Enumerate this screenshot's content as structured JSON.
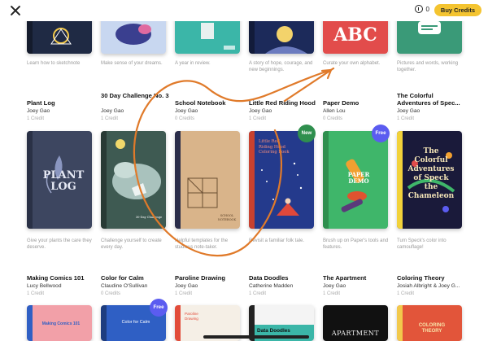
{
  "topbar": {
    "credits": "0",
    "buy_label": "Buy Credits"
  },
  "row1": [
    {
      "desc": "Learn how to sketchnote",
      "color": "#1f2a44",
      "accent": "#f2c94c"
    },
    {
      "desc": "Make sense of your dreams.",
      "color": "#c8d7f0",
      "accent": "#3a3f8f"
    },
    {
      "desc": "A year in review.",
      "color": "#3bb6a8",
      "accent": "#e8f0ef"
    },
    {
      "desc": "A story of hope, courage, and new beginnings.",
      "color": "#1c2a5a",
      "accent": "#f3d36b"
    },
    {
      "desc": "Curate your own alphabet.",
      "color": "#e24c4b",
      "accent": "#ffffff",
      "cover_text": "ABC"
    },
    {
      "desc": "Pictures and words, working together.",
      "color": "#3a9a78",
      "accent": "#ffffff"
    }
  ],
  "row2": [
    {
      "title": "Plant Log",
      "author": "Joey Gao",
      "cost": "1 Credit",
      "desc": "Give your plants the care they deserve.",
      "color": "#3d4660",
      "cover_text": "PLANT LOG"
    },
    {
      "title": "30 Day Challenge No. 3",
      "author": "Joey Gao",
      "cost": "1 Credit",
      "desc": "Challenge yourself to create every day.",
      "color": "#3e5a52",
      "cover_text": "30-Day Challenge"
    },
    {
      "title": "School Notebook",
      "author": "Joey Gao",
      "cost": "0 Credits",
      "desc": "Helpful templates for the studious note-taker.",
      "color": "#d9b48a",
      "cover_text": "SCHOOL NOTEBOOK"
    },
    {
      "title": "Little Red Riding Hood",
      "author": "Joey Gao",
      "cost": "1 Credit",
      "desc": "Revisit a familiar folk tale.",
      "color": "#243a8c",
      "cover_text": "Little Red Riding Hood Coloring Book",
      "badge": "New"
    },
    {
      "title": "Paper Demo",
      "author": "Allen Lou",
      "cost": "0 Credits",
      "desc": "Brush up on Paper's tools and features.",
      "color": "#3fb66a",
      "cover_text": "PAPER DEMO",
      "badge": "Free"
    },
    {
      "title": "The Colorful Adventures of Speck the Chameleon",
      "title_display": "The Colorful Adventures of Spec...",
      "author": "Joey Gao",
      "cost": "1 Credit",
      "desc": "Turn Speck's color into camouflage!",
      "color": "#1a1a3a",
      "cover_text": "The Colorful Adventures of Speck the Chameleon"
    }
  ],
  "row3": [
    {
      "title": "Making Comics 101",
      "author": "Lucy Bellwood",
      "cost": "1 Credit",
      "color": "#f2a0a8",
      "cover_text": "Making Comics 101"
    },
    {
      "title": "Color for Calm",
      "author": "Claudine O'Sullivan",
      "cost": "0 Credits",
      "color": "#2f5fc4",
      "cover_text": "Color for Calm",
      "badge": "Free"
    },
    {
      "title": "Paroline Drawing",
      "author": "Joey Gao",
      "cost": "1 Credit",
      "color": "#f5efe6",
      "cover_text": "Paroline Drawing"
    },
    {
      "title": "Data Doodles",
      "author": "Catherine Madden",
      "cost": "1 Credit",
      "color": "#f4f4f4",
      "cover_text": "Data Doodles"
    },
    {
      "title": "The Apartment",
      "author": "Joey Gao",
      "cost": "1 Credit",
      "color": "#111111",
      "cover_text": "APARTMENT"
    },
    {
      "title": "Coloring Theory",
      "author": "Josiah Albright & Joey G...",
      "cost": "1 Credit",
      "color": "#e2553a",
      "cover_text": "COLORING THEORY"
    }
  ],
  "colors": {
    "buy_button": "#f4c430",
    "badge_new": "#2f8f4e",
    "badge_free": "#5b5cf0",
    "scribble": "#e07a2a"
  }
}
